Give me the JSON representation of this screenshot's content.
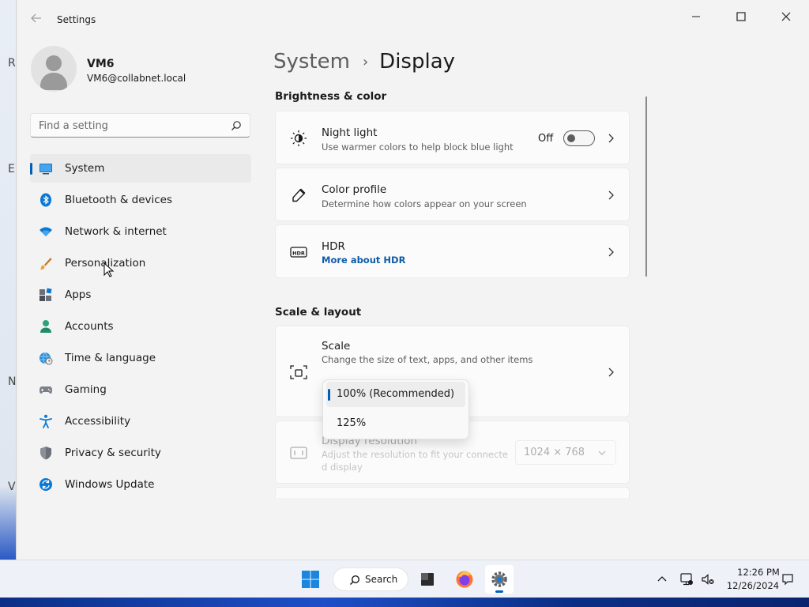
{
  "window": {
    "title": "Settings"
  },
  "profile": {
    "name": "VM6",
    "email": "VM6@collabnet.local"
  },
  "search": {
    "placeholder": "Find a setting"
  },
  "nav": {
    "items": [
      {
        "label": "System",
        "icon": "monitor-icon",
        "active": true
      },
      {
        "label": "Bluetooth & devices",
        "icon": "bluetooth-icon"
      },
      {
        "label": "Network & internet",
        "icon": "wifi-icon"
      },
      {
        "label": "Personalization",
        "icon": "brush-icon"
      },
      {
        "label": "Apps",
        "icon": "apps-icon"
      },
      {
        "label": "Accounts",
        "icon": "person-icon"
      },
      {
        "label": "Time & language",
        "icon": "globe-clock-icon"
      },
      {
        "label": "Gaming",
        "icon": "gamepad-icon"
      },
      {
        "label": "Accessibility",
        "icon": "accessibility-icon"
      },
      {
        "label": "Privacy & security",
        "icon": "shield-icon"
      },
      {
        "label": "Windows Update",
        "icon": "update-icon"
      }
    ]
  },
  "breadcrumb": {
    "parent": "System",
    "separator": "›",
    "current": "Display"
  },
  "sections": {
    "brightness": "Brightness & color",
    "scale_layout": "Scale & layout"
  },
  "cards": {
    "night_light": {
      "title": "Night light",
      "desc": "Use warmer colors to help block blue light",
      "state": "Off"
    },
    "color_profile": {
      "title": "Color profile",
      "desc": "Determine how colors appear on your screen"
    },
    "hdr": {
      "title": "HDR",
      "link": "More about HDR"
    },
    "scale": {
      "title": "Scale",
      "desc": "Change the size of text, apps, and other items"
    },
    "resolution": {
      "title": "Display resolution",
      "desc_line1": "Adjust the resolution to fit your connecte",
      "desc_line2": "d display",
      "value": "1024 × 768"
    }
  },
  "scale_dropdown": {
    "options": [
      "100% (Recommended)",
      "125%"
    ],
    "selected_index": 0
  },
  "taskbar": {
    "search_label": "Search",
    "time": "12:26 PM",
    "date": "12/26/2024"
  },
  "colors": {
    "accent": "#005fb8",
    "link": "#0f5ca8"
  }
}
